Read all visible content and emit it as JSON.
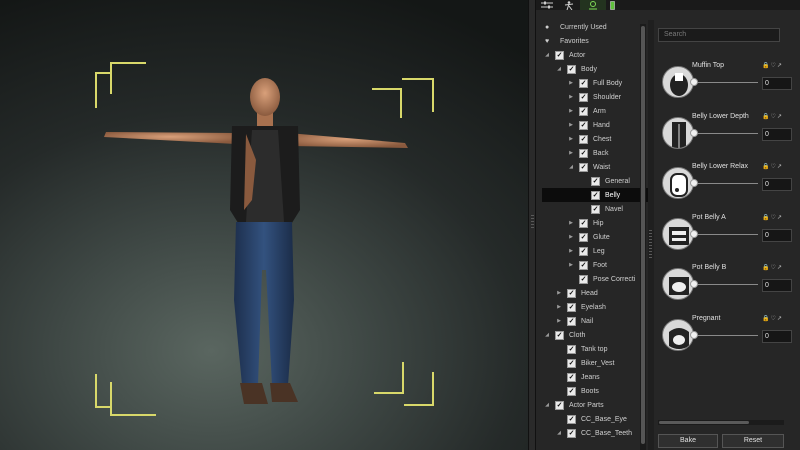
{
  "top_tabs": [
    {
      "icon": "sliders-icon"
    },
    {
      "icon": "pose-figure-icon"
    },
    {
      "icon": "morph-icon"
    },
    {
      "icon": "battery-icon"
    }
  ],
  "tree": {
    "currently_used": "Currently Used",
    "favorites": "Favorites",
    "items": [
      {
        "label": "Actor",
        "level": 0,
        "expanded": true,
        "checked": true
      },
      {
        "label": "Body",
        "level": 1,
        "expanded": true,
        "checked": true
      },
      {
        "label": "Full Body",
        "level": 2,
        "expanded": false,
        "checked": true
      },
      {
        "label": "Shoulder",
        "level": 2,
        "expanded": false,
        "checked": true
      },
      {
        "label": "Arm",
        "level": 2,
        "expanded": false,
        "checked": true
      },
      {
        "label": "Hand",
        "level": 2,
        "expanded": false,
        "checked": true
      },
      {
        "label": "Chest",
        "level": 2,
        "expanded": false,
        "checked": true
      },
      {
        "label": "Back",
        "level": 2,
        "expanded": false,
        "checked": true
      },
      {
        "label": "Waist",
        "level": 2,
        "expanded": true,
        "checked": true
      },
      {
        "label": "General",
        "level": 3,
        "leaf": true,
        "checked": true
      },
      {
        "label": "Belly",
        "level": 3,
        "leaf": true,
        "checked": true,
        "selected": true
      },
      {
        "label": "Navel",
        "level": 3,
        "leaf": true,
        "checked": true
      },
      {
        "label": "Hip",
        "level": 2,
        "expanded": false,
        "checked": true
      },
      {
        "label": "Glute",
        "level": 2,
        "expanded": false,
        "checked": true
      },
      {
        "label": "Leg",
        "level": 2,
        "expanded": false,
        "checked": true
      },
      {
        "label": "Foot",
        "level": 2,
        "expanded": false,
        "checked": true
      },
      {
        "label": "Pose Correcti",
        "level": 2,
        "leaf": true,
        "checked": true
      },
      {
        "label": "Head",
        "level": 1,
        "expanded": false,
        "checked": true
      },
      {
        "label": "Eyelash",
        "level": 1,
        "expanded": false,
        "checked": true
      },
      {
        "label": "Nail",
        "level": 1,
        "expanded": false,
        "checked": true
      },
      {
        "label": "Cloth",
        "level": 0,
        "expanded": true,
        "checked": true
      },
      {
        "label": "Tank top",
        "level": 1,
        "leaf": true,
        "checked": true
      },
      {
        "label": "Biker_Vest",
        "level": 1,
        "leaf": true,
        "checked": true
      },
      {
        "label": "Jeans",
        "level": 1,
        "leaf": true,
        "checked": true
      },
      {
        "label": "Boots",
        "level": 1,
        "leaf": true,
        "checked": true
      },
      {
        "label": "Actor Parts",
        "level": 0,
        "expanded": true,
        "checked": true
      },
      {
        "label": "CC_Base_Eye",
        "level": 1,
        "leaf": true,
        "checked": true
      },
      {
        "label": "CC_Base_Teeth",
        "level": 1,
        "expanded": true,
        "checked": true
      }
    ]
  },
  "search": {
    "placeholder": "Search"
  },
  "sliders": [
    {
      "name": "Muffin Top",
      "value": "0",
      "level": 0.0
    },
    {
      "name": "Belly Lower Depth",
      "value": "0",
      "level": 0.0
    },
    {
      "name": "Belly Lower Relax",
      "value": "0",
      "level": 0.0
    },
    {
      "name": "Pot Belly A",
      "value": "0",
      "level": 0.0
    },
    {
      "name": "Pot Belly B",
      "value": "0",
      "level": 0.0
    },
    {
      "name": "Pregnant",
      "value": "0",
      "level": 0.0
    }
  ],
  "slider_icons": "🔒♡↗",
  "buttons": {
    "bake": "Bake",
    "reset": "Reset"
  },
  "colors": {
    "bracket": "#d8d86a",
    "active_tab": "#7ed957",
    "selected_row": "#0c0c0c"
  }
}
